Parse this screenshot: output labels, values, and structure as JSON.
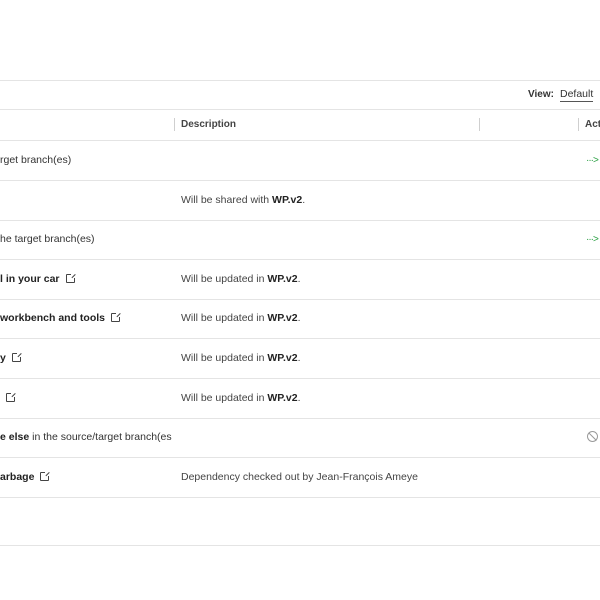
{
  "toolbar": {
    "view_label": "View:",
    "view_value": "Default"
  },
  "columns": {
    "description": "Description",
    "actions": "Act"
  },
  "rows": [
    {
      "name_bold": "",
      "name_rest": "rget branch(es)",
      "desc_pre": "",
      "desc_bold": "",
      "desc_post": "",
      "action": "arrow"
    },
    {
      "name_bold": "",
      "name_rest": "",
      "desc_pre": "Will be shared with ",
      "desc_bold": "WP.v2",
      "desc_post": ".",
      "action": ""
    },
    {
      "name_bold": "",
      "name_rest": "he target branch(es)",
      "desc_pre": "",
      "desc_bold": "",
      "desc_post": "",
      "action": "arrow"
    },
    {
      "name_bold": "l in your car",
      "name_rest": "",
      "desc_pre": "Will be updated in ",
      "desc_bold": "WP.v2",
      "desc_post": ".",
      "action": "",
      "ext": true
    },
    {
      "name_bold": "workbench and tools",
      "name_rest": "",
      "desc_pre": "Will be updated in ",
      "desc_bold": "WP.v2",
      "desc_post": ".",
      "action": "",
      "ext": true
    },
    {
      "name_bold": "y",
      "name_rest": "",
      "desc_pre": "Will be updated in ",
      "desc_bold": "WP.v2",
      "desc_post": ".",
      "action": "",
      "ext": true
    },
    {
      "name_bold": "",
      "name_rest": "",
      "desc_pre": "Will be updated in ",
      "desc_bold": "WP.v2",
      "desc_post": ".",
      "action": "",
      "ext": true
    },
    {
      "name_bold": "e else",
      "name_rest": " in the source/target branch(es",
      "desc_pre": "",
      "desc_bold": "",
      "desc_post": "",
      "action": "blocked"
    },
    {
      "name_bold": "arbage",
      "name_rest": "",
      "desc_pre": "Dependency checked out by Jean-François Ameye",
      "desc_bold": "",
      "desc_post": "",
      "action": "",
      "ext": true
    }
  ],
  "icons": {
    "arrow": "dashed-arrow-right-icon",
    "blocked": "blocked-circle-icon",
    "external": "external-link-icon"
  },
  "colors": {
    "arrow": "#2aa043",
    "blocked": "#9a9a9a",
    "divider": "#e4e4e4"
  }
}
